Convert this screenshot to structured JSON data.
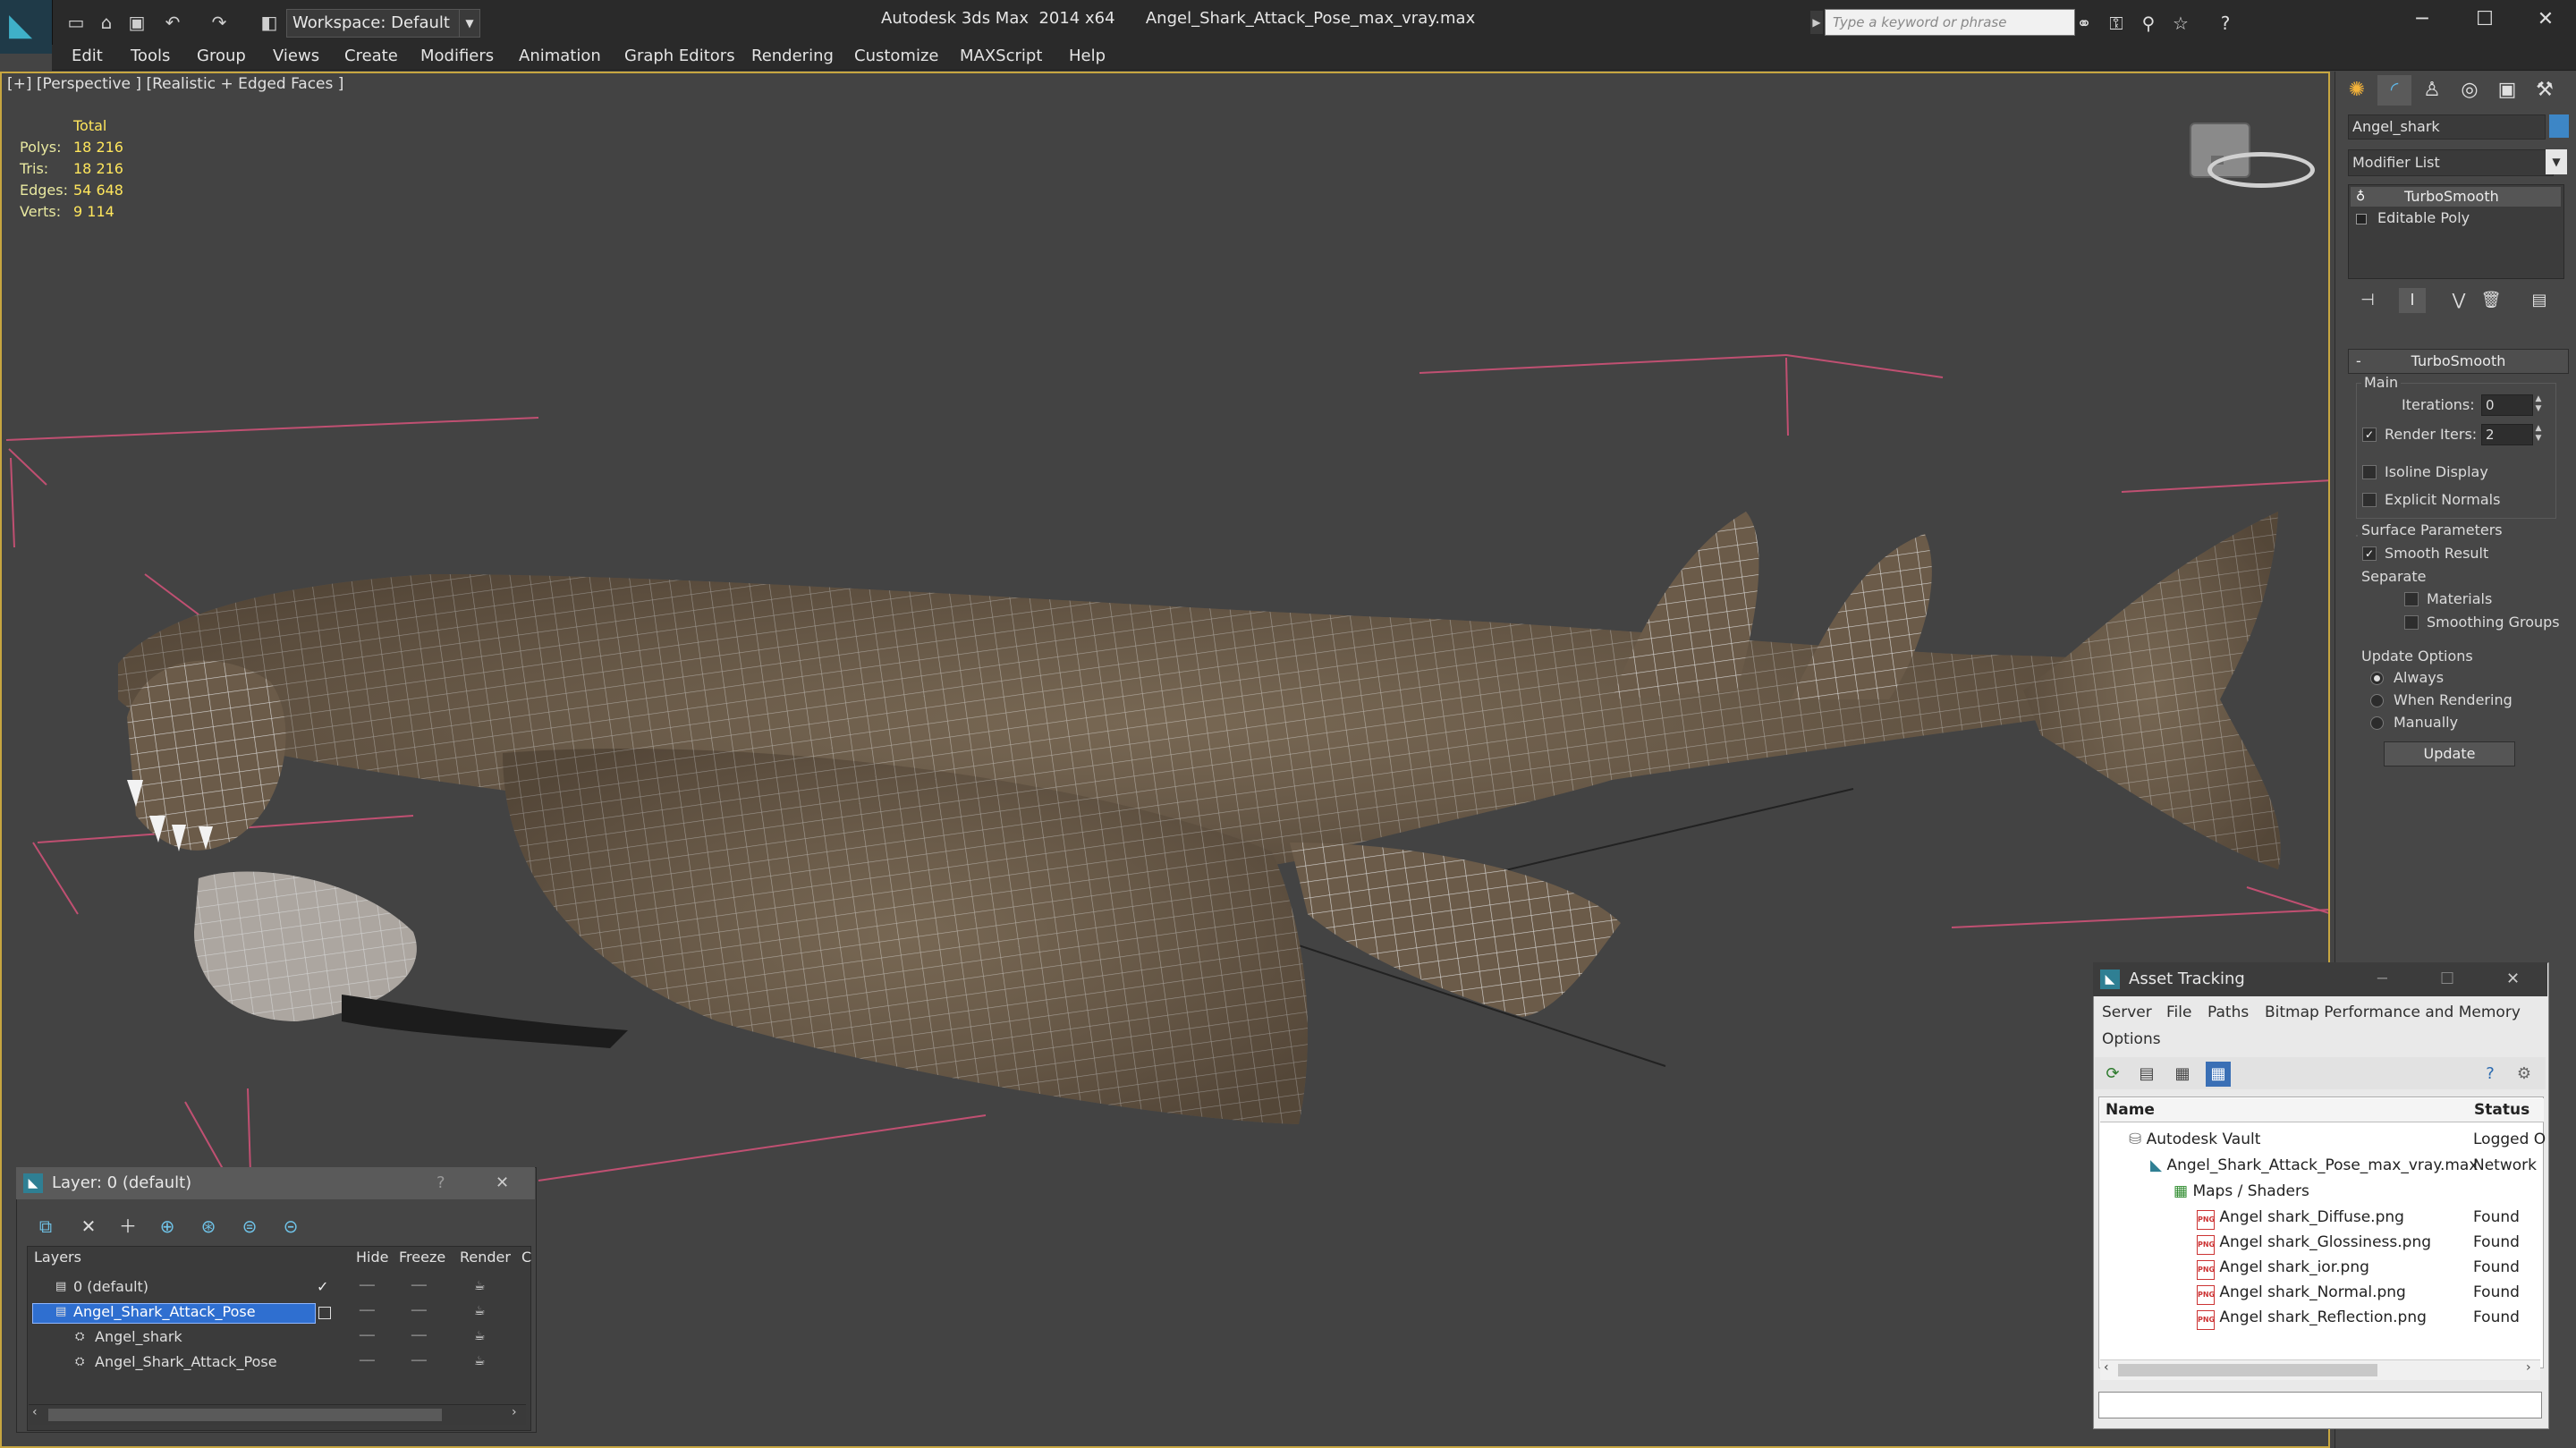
{
  "titlebar": {
    "workspace": "Workspace: Default",
    "title": "Autodesk 3ds Max  2014 x64      Angel_Shark_Attack_Pose_max_vray.max",
    "search_placeholder": "Type a keyword or phrase"
  },
  "menu": [
    "Edit",
    "Tools",
    "Group",
    "Views",
    "Create",
    "Modifiers",
    "Animation",
    "Graph Editors",
    "Rendering",
    "Customize",
    "MAXScript",
    "Help"
  ],
  "viewport": {
    "label": "[+] [Perspective ] [Realistic + Edged Faces ]",
    "stats": {
      "total": "Total",
      "polys_label": "Polys:",
      "polys": "18 216",
      "tris_label": "Tris:",
      "tris": "18 216",
      "edges_label": "Edges:",
      "edges": "54 648",
      "verts_label": "Verts:",
      "verts": "9 114"
    }
  },
  "command_panel": {
    "object_name": "Angel_shark",
    "object_color": "#3d86c6",
    "modifier_list": "Modifier List",
    "stack": [
      "TurboSmooth",
      "Editable Poly"
    ],
    "rollout_title": "TurboSmooth",
    "main_label": "Main",
    "iterations_label": "Iterations:",
    "iterations": "0",
    "render_iters_label": "Render Iters:",
    "render_iters": "2",
    "isoline": "Isoline Display",
    "explicit_normals": "Explicit Normals",
    "surface_params": "Surface Parameters",
    "smooth_result": "Smooth Result",
    "separate": "Separate",
    "materials": "Materials",
    "smoothing_groups": "Smoothing Groups",
    "update_options": "Update Options",
    "always": "Always",
    "when_rendering": "When Rendering",
    "manually": "Manually",
    "update": "Update"
  },
  "layer_dialog": {
    "title": "Layer: 0 (default)",
    "columns": [
      "Layers",
      "Hide",
      "Freeze",
      "Render",
      "C"
    ],
    "rows": [
      {
        "name": "0 (default)"
      },
      {
        "name": "Angel_Shark_Attack_Pose"
      },
      {
        "name": "Angel_shark"
      },
      {
        "name": "Angel_Shark_Attack_Pose"
      }
    ]
  },
  "asset_tracking": {
    "title": "Asset Tracking",
    "menu": [
      "Server",
      "File",
      "Paths",
      "Bitmap Performance and Memory",
      "Options"
    ],
    "columns": [
      "Name",
      "Status"
    ],
    "rows": [
      {
        "name": "Autodesk Vault",
        "status": "Logged O"
      },
      {
        "name": "Angel_Shark_Attack_Pose_max_vray.max",
        "status": "Network"
      },
      {
        "name": "Maps / Shaders",
        "status": ""
      },
      {
        "name": "Angel shark_Diffuse.png",
        "status": "Found"
      },
      {
        "name": "Angel shark_Glossiness.png",
        "status": "Found"
      },
      {
        "name": "Angel shark_ior.png",
        "status": "Found"
      },
      {
        "name": "Angel shark_Normal.png",
        "status": "Found"
      },
      {
        "name": "Angel shark_Reflection.png",
        "status": "Found"
      }
    ]
  }
}
